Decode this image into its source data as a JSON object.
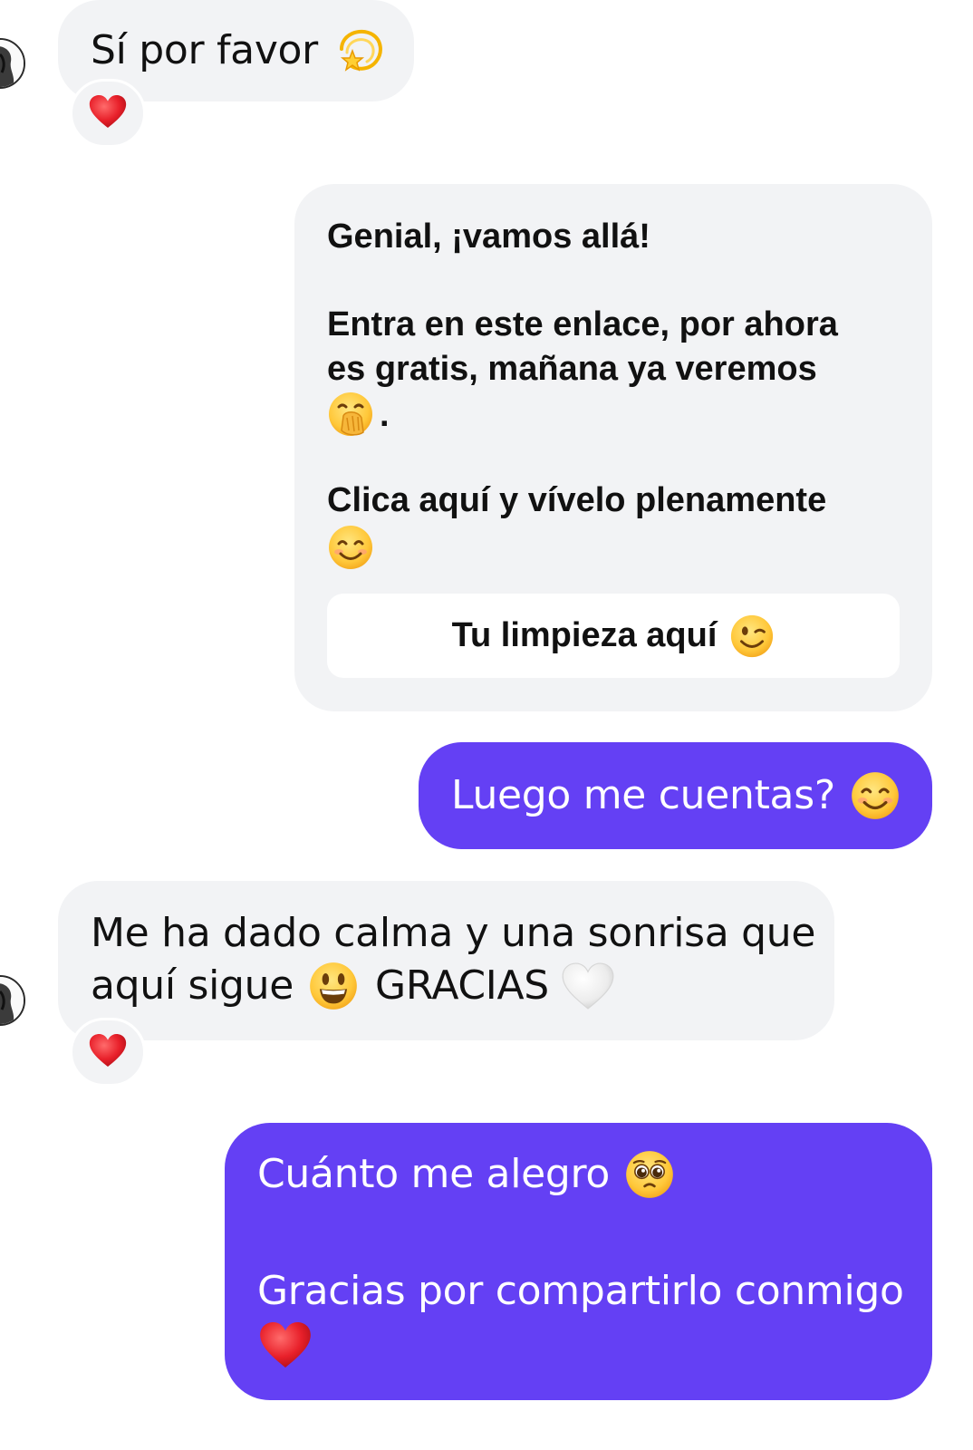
{
  "conversation": {
    "messages": [
      {
        "sender": "contact",
        "text": "Sí por favor",
        "emoji": "dizzy-icon",
        "reaction": "heart"
      },
      {
        "sender": "me",
        "style": "card",
        "title": "Genial, ¡vamos allá!",
        "paragraph_1_line_1": "Entra en este enlace, por ahora",
        "paragraph_1_line_2": "es gratis, mañana ya veremos",
        "paragraph_1_suffix": ".",
        "paragraph_1_emoji": "hand-over-mouth-icon",
        "paragraph_2": "Clica aquí y vívelo plenamente",
        "paragraph_2_emoji": "smiling-face-icon",
        "button_label": "Tu limpieza aquí",
        "button_emoji": "winking-face-icon"
      },
      {
        "sender": "me",
        "text": "Luego me cuentas?",
        "emoji": "smiling-face-icon"
      },
      {
        "sender": "contact",
        "line_1": "Me ha dado calma y una sonrisa que",
        "line_2_a": "aquí sigue",
        "line_2_emoji_1": "grinning-face-icon",
        "line_2_b": "GRACIAS",
        "line_2_emoji_2": "white-heart-icon",
        "reaction": "heart"
      },
      {
        "sender": "me",
        "line_1": "Cuánto me alegro",
        "line_1_emoji": "pleading-face-icon",
        "line_2": "Gracias por compartirlo conmigo",
        "line_2_emoji": "red-heart-icon"
      }
    ]
  },
  "colors": {
    "outgoing_bubble": "#6440f4",
    "incoming_bubble": "#f2f3f5",
    "reaction_heart": "#e8202a"
  }
}
